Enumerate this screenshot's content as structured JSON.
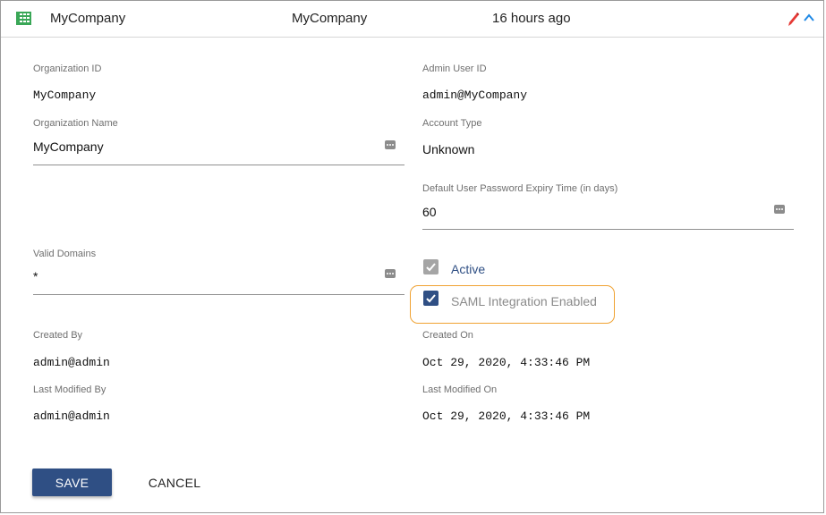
{
  "header": {
    "org_name": "MyCompany",
    "org_display": "MyCompany",
    "updated": "16 hours ago",
    "icons": [
      "grid-icon",
      "edit-icon",
      "chevron-up-icon"
    ]
  },
  "form": {
    "organization_id": {
      "label": "Organization ID",
      "value": "MyCompany"
    },
    "organization_name": {
      "label": "Organization Name",
      "value": "MyCompany"
    },
    "valid_domains": {
      "label": "Valid Domains",
      "value": "*"
    },
    "created_by": {
      "label": "Created By",
      "value": "admin@admin"
    },
    "last_modified_by": {
      "label": "Last Modified By",
      "value": "admin@admin"
    },
    "admin_user_id": {
      "label": "Admin User ID",
      "value": "admin@MyCompany"
    },
    "account_type": {
      "label": "Account Type",
      "value": "Unknown"
    },
    "password_expiry": {
      "label": "Default User Password Expiry Time (in days)",
      "value": "60"
    },
    "active": {
      "label": "Active",
      "checked": true
    },
    "saml": {
      "label": "SAML Integration Enabled",
      "checked": true
    },
    "created_on": {
      "label": "Created On",
      "value": "Oct 29, 2020, 4:33:46 PM"
    },
    "last_modified_on": {
      "label": "Last Modified On",
      "value": "Oct 29, 2020, 4:33:46 PM"
    }
  },
  "actions": {
    "save": "SAVE",
    "cancel": "CANCEL"
  },
  "colors": {
    "accent": "#2f4f84",
    "highlight": "#f0a232",
    "grid_icon": "#3aa757",
    "edit_icon": "#e53935",
    "chevron": "#1e88e5",
    "active_label": "#2f4f84",
    "saml_label": "#8a8a8a"
  }
}
